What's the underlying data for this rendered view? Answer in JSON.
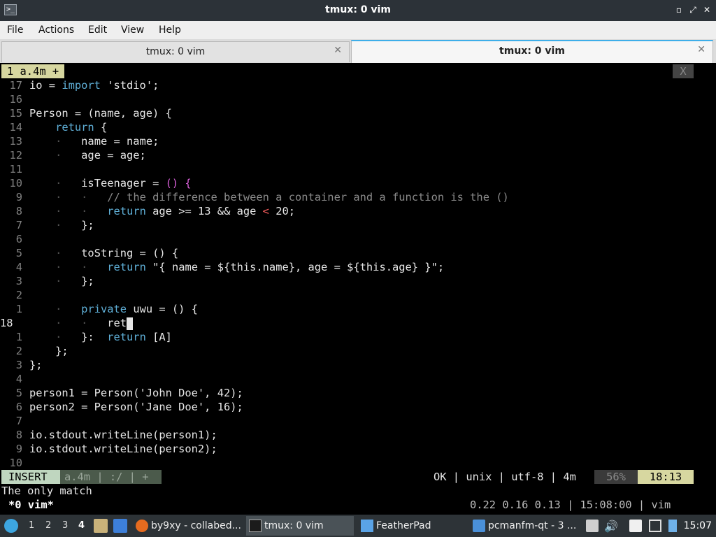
{
  "window": {
    "title": "tmux: 0 vim",
    "minimize": "▫",
    "maximize": "⤢",
    "close": "✕"
  },
  "menu": [
    "File",
    "Actions",
    "Edit",
    "View",
    "Help"
  ],
  "tabs": [
    {
      "label": "tmux: 0 vim",
      "close": "✕"
    },
    {
      "label": "tmux: 0 vim",
      "close": "✕"
    }
  ],
  "vim": {
    "buffer_tab": "1  a.4m  +",
    "buffer_close": "X",
    "lines": [
      {
        "n": "17",
        "text": "io = import 'stdio';"
      },
      {
        "n": "16",
        "text": ""
      },
      {
        "n": "15",
        "text": "Person = (name, age) {"
      },
      {
        "n": "14",
        "text": "    return {"
      },
      {
        "n": "13",
        "text": "    ·   name = name;"
      },
      {
        "n": "12",
        "text": "    ·   age = age;"
      },
      {
        "n": "11",
        "text": ""
      },
      {
        "n": "10",
        "text": "    ·   isTeenager = () {"
      },
      {
        "n": "9",
        "text": "    ·   ·   // the difference between a container and a function is the ()"
      },
      {
        "n": "8",
        "text": "    ·   ·   return age >= 13 && age < 20;"
      },
      {
        "n": "7",
        "text": "    ·   };"
      },
      {
        "n": "6",
        "text": ""
      },
      {
        "n": "5",
        "text": "    ·   toString = () {"
      },
      {
        "n": "4",
        "text": "    ·   ·   return \"{ name = ${this.name}, age = ${this.age} }\";"
      },
      {
        "n": "3",
        "text": "    ·   };"
      },
      {
        "n": "2",
        "text": ""
      },
      {
        "n": "1",
        "text": "    ·   private uwu = () {"
      },
      {
        "n": "18",
        "text": "    ·   ·   ret"
      },
      {
        "n": "1",
        "text": "    ·   }:  return [A]"
      },
      {
        "n": "2",
        "text": "    };"
      },
      {
        "n": "3",
        "text": "};"
      },
      {
        "n": "4",
        "text": ""
      },
      {
        "n": "5",
        "text": "person1 = Person('John Doe', 42);"
      },
      {
        "n": "6",
        "text": "person2 = Person('Jane Doe', 16);"
      },
      {
        "n": "7",
        "text": ""
      },
      {
        "n": "8",
        "text": "io.stdout.writeLine(person1);"
      },
      {
        "n": "9",
        "text": "io.stdout.writeLine(person2);"
      },
      {
        "n": "10",
        "text": ""
      }
    ],
    "status": {
      "mode": "INSERT",
      "info": "a.4m  |  :/  |  +",
      "right": "OK  |  unix  |  utf-8  |  4m",
      "percent": "56%",
      "position": "18:13"
    },
    "message": "The only match"
  },
  "tmux": {
    "window": "*0 vim*",
    "right": "0.22 0.16 0.13  |  15:08:00  |  vim"
  },
  "taskbar": {
    "workspaces": [
      "1",
      "2",
      "3",
      "4"
    ],
    "tasks": [
      {
        "label": "by9xy - collabed..."
      },
      {
        "label": "tmux: 0 vim"
      },
      {
        "label": "FeatherPad"
      },
      {
        "label": "pcmanfm-qt - 3 ..."
      }
    ],
    "clock": "15:07"
  }
}
